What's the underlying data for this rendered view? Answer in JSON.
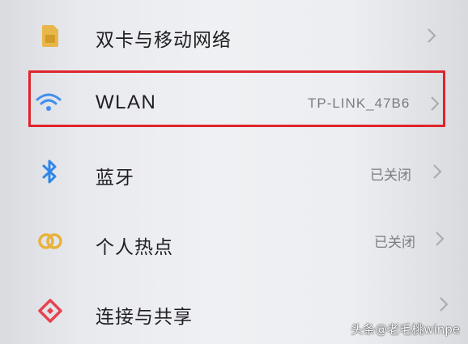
{
  "settings": {
    "items": [
      {
        "label": "双卡与移动网络",
        "value": "",
        "icon": "sim-card-icon"
      },
      {
        "label": "WLAN",
        "value": "TP-LINK_47B6",
        "icon": "wifi-icon"
      },
      {
        "label": "蓝牙",
        "value": "已关闭",
        "icon": "bluetooth-icon"
      },
      {
        "label": "个人热点",
        "value": "已关闭",
        "icon": "hotspot-icon"
      },
      {
        "label": "连接与共享",
        "value": "",
        "icon": "connection-share-icon"
      }
    ]
  },
  "watermark": "头条@老毛桃winpe",
  "colors": {
    "highlight": "#e0242b",
    "sim_icon": "#e9b64a",
    "wifi_icon": "#3f8ff0",
    "bluetooth_icon": "#2f86e8",
    "hotspot_icon": "#e8b23c",
    "share_icon": "#e6434f",
    "chevron": "#a9aab0"
  }
}
